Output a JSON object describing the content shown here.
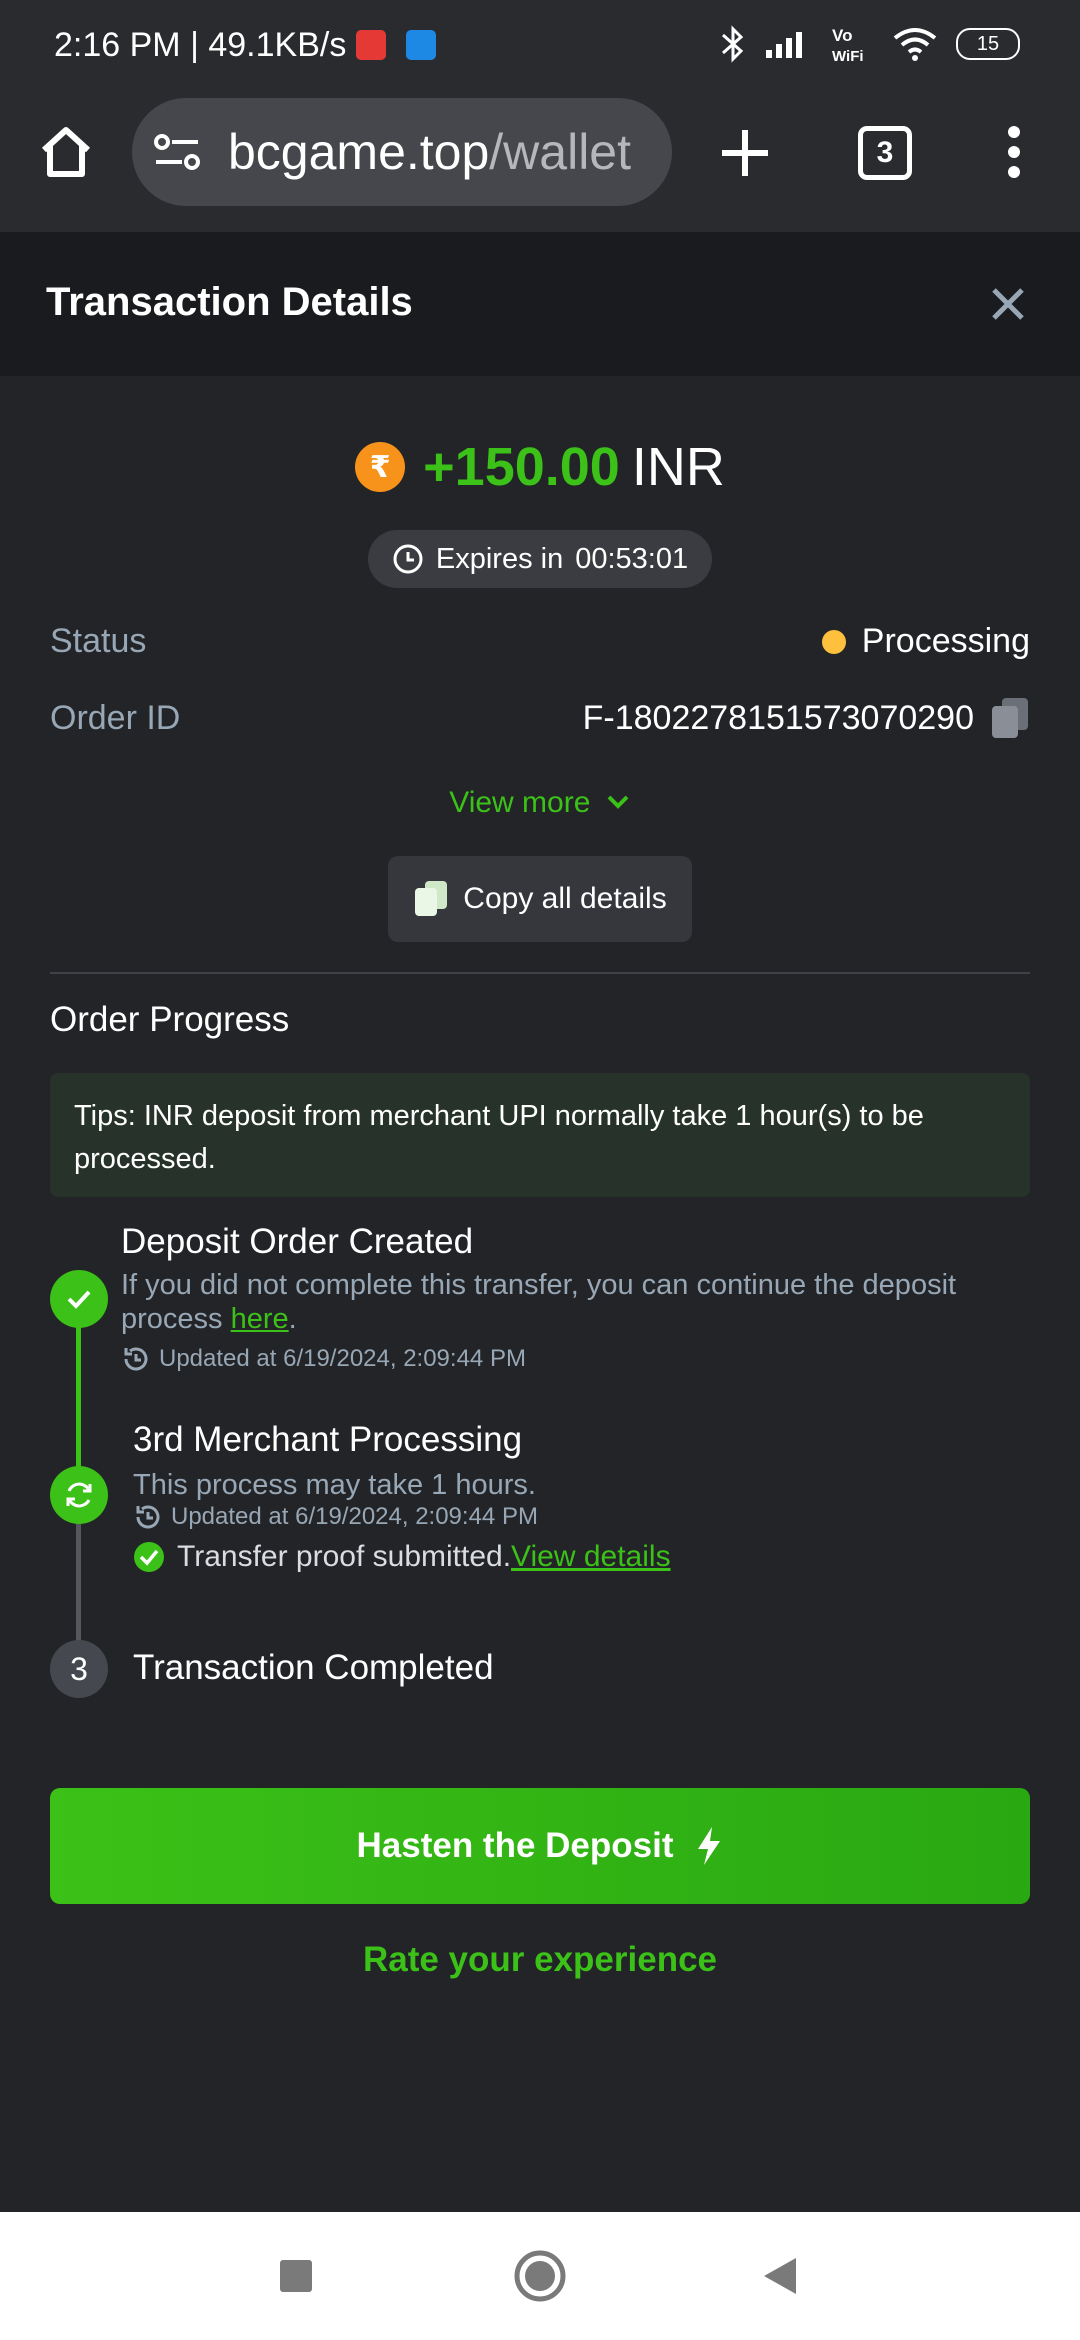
{
  "status_bar": {
    "time": "2:16 PM | 49.1KB/s",
    "battery": "15"
  },
  "browser": {
    "url_host": "bcgame.top",
    "url_path": "/wallet",
    "tab_count": "3"
  },
  "header": {
    "title": "Transaction Details"
  },
  "transaction": {
    "currency_symbol": "₹",
    "amount": "+150.00",
    "currency": "INR",
    "expires_label": "Expires in",
    "expires_time": "00:53:01",
    "status_label": "Status",
    "status_value": "Processing",
    "order_id_label": "Order ID",
    "order_id_value": "F-1802278151573070290",
    "view_more": "View more",
    "copy_all": "Copy all details"
  },
  "progress": {
    "title": "Order Progress",
    "tips": "Tips: INR deposit from merchant UPI normally take 1 hour(s) to be processed.",
    "steps": [
      {
        "title": "Deposit Order Created",
        "desc_before": "If you did not complete this transfer, you can continue the deposit process ",
        "desc_link": "here",
        "desc_after": ".",
        "updated": "Updated at 6/19/2024, 2:09:44 PM"
      },
      {
        "title": "3rd Merchant Processing",
        "desc": "This process may take 1 hours.",
        "updated": "Updated at 6/19/2024, 2:09:44 PM",
        "proof": "Transfer proof submitted.",
        "proof_link": "View details"
      },
      {
        "number": "3",
        "title": "Transaction Completed"
      }
    ]
  },
  "actions": {
    "hasten": "Hasten the Deposit",
    "rate": "Rate your experience"
  },
  "colors": {
    "accent": "#3bc117",
    "status_dot": "#ffc13d",
    "coin": "#f7931a",
    "background": "#232428"
  }
}
